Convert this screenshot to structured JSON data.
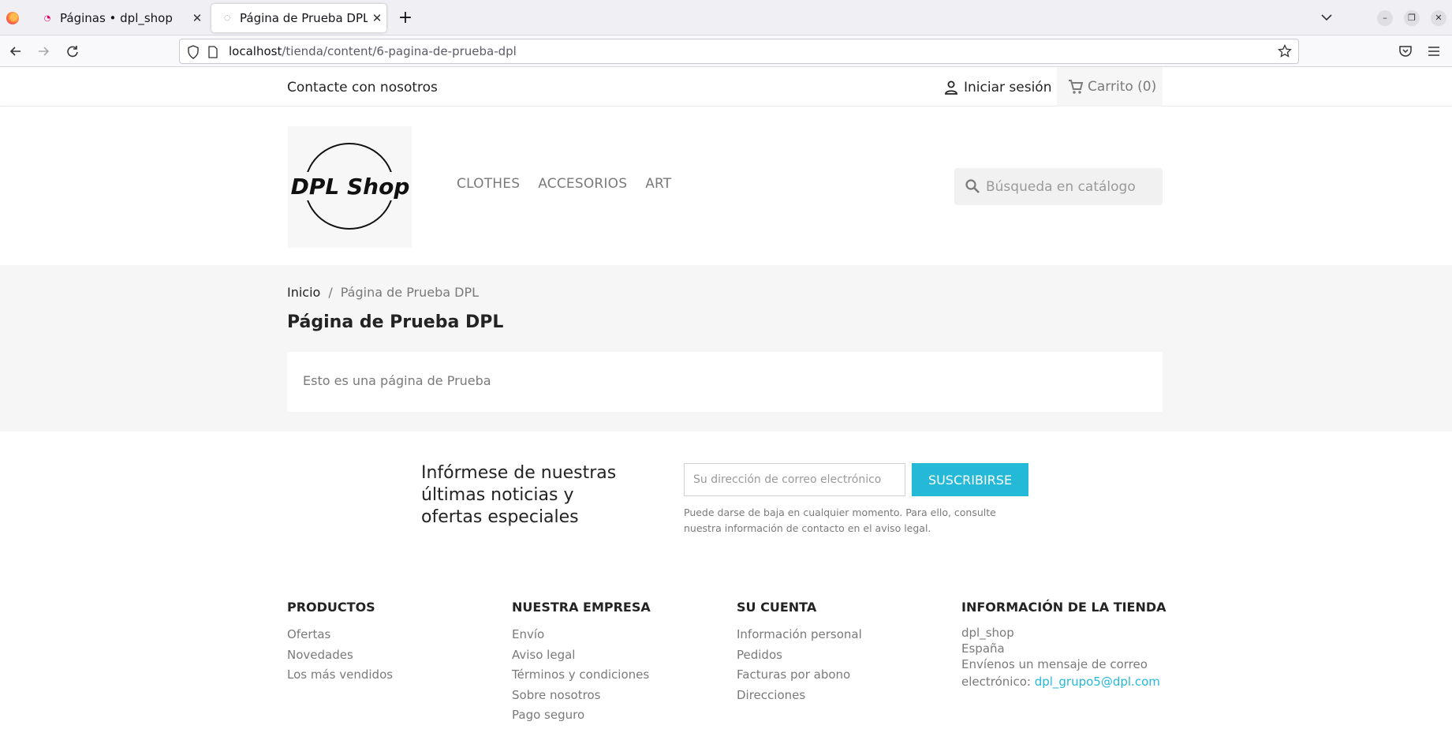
{
  "browser": {
    "tabs": [
      {
        "title": "Páginas • dpl_shop"
      },
      {
        "title": "Página de Prueba DPL"
      }
    ],
    "new_tab": "+",
    "url_host": "localhost",
    "url_path": "/tienda/content/6-pagina-de-prueba-dpl"
  },
  "topbar": {
    "contact": "Contacte con nosotros",
    "login": "Iniciar sesión",
    "cart": "Carrito (0)"
  },
  "header": {
    "logo_text": "DPL Shop",
    "menu": [
      "CLOTHES",
      "ACCESORIOS",
      "ART"
    ],
    "search_placeholder": "Búsqueda en catálogo"
  },
  "breadcrumb": {
    "home": "Inicio",
    "separator": "/",
    "current": "Página de Prueba DPL"
  },
  "page": {
    "title": "Página de Prueba DPL",
    "content": "Esto es una página de Prueba"
  },
  "newsletter": {
    "heading": "Infórmese de nuestras últimas noticias y ofertas especiales",
    "placeholder": "Su dirección de correo electrónico",
    "button": "SUSCRIBIRSE",
    "note": "Puede darse de baja en cualquier momento. Para ello, consulte nuestra información de contacto en el aviso legal."
  },
  "footer": {
    "productos": {
      "title": "PRODUCTOS",
      "links": [
        "Ofertas",
        "Novedades",
        "Los más vendidos"
      ]
    },
    "empresa": {
      "title": "NUESTRA EMPRESA",
      "links": [
        "Envío",
        "Aviso legal",
        "Términos y condiciones",
        "Sobre nosotros",
        "Pago seguro"
      ]
    },
    "cuenta": {
      "title": "SU CUENTA",
      "links": [
        "Información personal",
        "Pedidos",
        "Facturas por abono",
        "Direcciones"
      ]
    },
    "tienda": {
      "title": "INFORMACIÓN DE LA TIENDA",
      "name": "dpl_shop",
      "country": "España",
      "mail_text": "Envíenos un mensaje de correo electrónico:",
      "email": "dpl_grupo5@dpl.com"
    }
  },
  "colors": {
    "accent": "#24b9d7",
    "text": "#232323",
    "muted": "#7a7a7a"
  }
}
